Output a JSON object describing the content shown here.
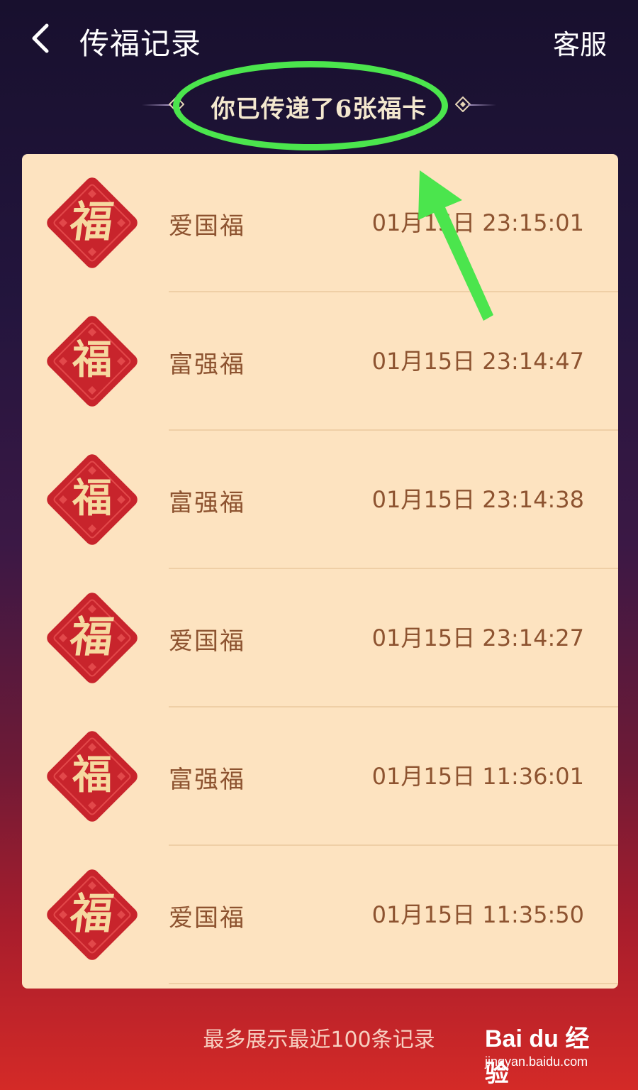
{
  "header": {
    "title": "传福记录",
    "service_label": "客服",
    "back_icon": "chevron-left-icon"
  },
  "banner": {
    "text": "你已传递了6张福卡"
  },
  "records": [
    {
      "name": "爱国福",
      "time": "01月15日 23:15:01",
      "style": "cursive"
    },
    {
      "name": "富强福",
      "time": "01月15日 23:14:47",
      "style": "bold"
    },
    {
      "name": "富强福",
      "time": "01月15日 23:14:38",
      "style": "bold"
    },
    {
      "name": "爱国福",
      "time": "01月15日 23:14:27",
      "style": "cursive"
    },
    {
      "name": "富强福",
      "time": "01月15日 11:36:01",
      "style": "bold"
    },
    {
      "name": "爱国福",
      "time": "01月15日 11:35:50",
      "style": "cursive"
    }
  ],
  "footer": {
    "note": "最多展示最近100条记录"
  },
  "emblem_char": "福",
  "watermark": {
    "logo": "Bai du 经验",
    "url": "jingyan.baidu.com"
  },
  "colors": {
    "card_bg": "#fde3c0",
    "emblem_red": "#c8242c",
    "text_brown": "#8d5330",
    "annotation_green": "#4be54d"
  }
}
